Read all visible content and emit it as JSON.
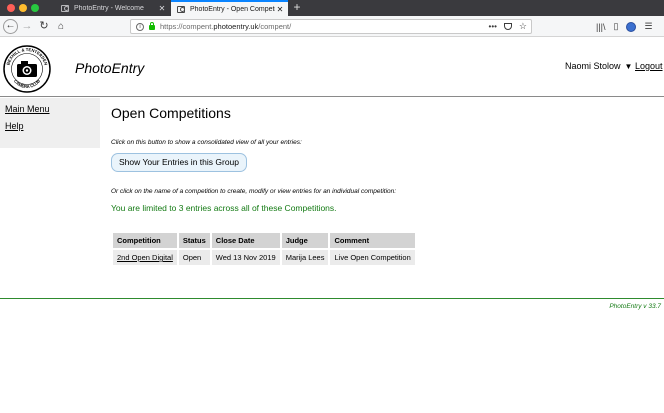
{
  "browser": {
    "tabs": [
      {
        "title": "PhotoEntry - Welcome"
      },
      {
        "title": "PhotoEntry - Open Competition"
      }
    ],
    "url_prefix": "https://compent.",
    "url_domain": "photoentry.uk",
    "url_path": "/compent/",
    "dots": "•••"
  },
  "header": {
    "brand": "PhotoEntry",
    "user_name": "Naomi Stolow",
    "logout_label": "Logout",
    "logo_text_top": "BEXHILL & TENTERDEN",
    "logo_text_bottom": "CAMERA CLUB"
  },
  "sidebar": {
    "items": [
      {
        "label": "Main Menu"
      },
      {
        "label": "Help"
      }
    ]
  },
  "main": {
    "heading": "Open Competitions",
    "intro": "Click on this button to show a consolidated view of all your entries:",
    "group_button": "Show Your Entries in this Group",
    "or_text": "Or click on the name of a competition to create, modify or view entries for an individual competition:",
    "limit_text": "You are limited to 3 entries across all of these Competitions."
  },
  "table": {
    "headers": [
      "Competition",
      "Status",
      "Close Date",
      "Judge",
      "Comment"
    ],
    "rows": [
      [
        "2nd Open Digital",
        "Open",
        "Wed 13 Nov 2019",
        "Marija Lees",
        "Live Open Competition"
      ]
    ]
  },
  "footer": {
    "version": "PhotoEntry v 33.7"
  },
  "colors": {
    "accent_green": "#137a13",
    "tab_highlight": "#0a84ff",
    "button_bg": "#eaf4fb"
  }
}
